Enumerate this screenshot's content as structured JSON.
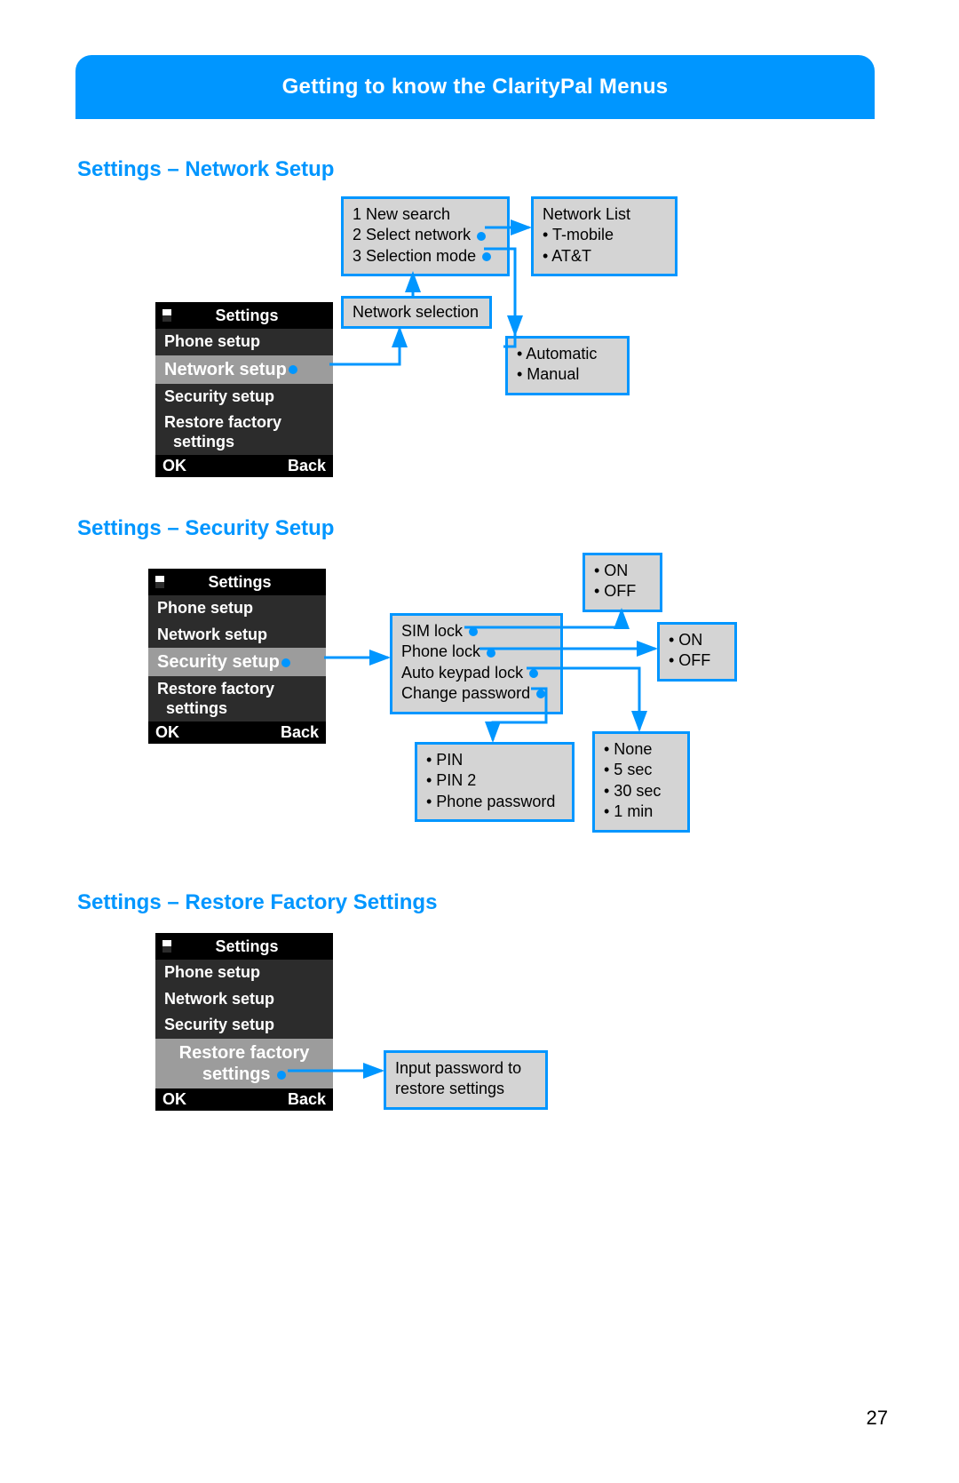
{
  "banner": "Getting to know the ClarityPal Menus",
  "page_number": "27",
  "phone": {
    "title": "Settings",
    "items": [
      "Phone setup",
      "Network setup",
      "Security setup",
      "Restore factory settings"
    ],
    "ok": "OK",
    "back": "Back"
  },
  "sec1": {
    "heading": "Settings – Network Setup",
    "menu": {
      "l1": "1 New search",
      "l2": "2 Select network",
      "l3": "3 Selection mode"
    },
    "netsel": "Network selection",
    "networks": {
      "title": "Network List",
      "a": "• T-mobile",
      "b": "• AT&T"
    },
    "modes": {
      "a": "• Automatic",
      "b": "• Manual"
    }
  },
  "sec2": {
    "heading": "Settings – Security Setup",
    "menu": {
      "a": "SIM lock",
      "b": "Phone lock",
      "c": "Auto keypad lock",
      "d": "Change password"
    },
    "onoff": {
      "a": "• ON",
      "b": "• OFF"
    },
    "pins": {
      "a": "• PIN",
      "b": "• PIN 2",
      "c": "• Phone password"
    },
    "times": {
      "a": "• None",
      "b": "• 5 sec",
      "c": "• 30 sec",
      "d": "• 1 min"
    }
  },
  "sec3": {
    "heading": "Settings – Restore Factory Settings",
    "prompt": {
      "a": "Input password to",
      "b": "restore settings"
    }
  }
}
